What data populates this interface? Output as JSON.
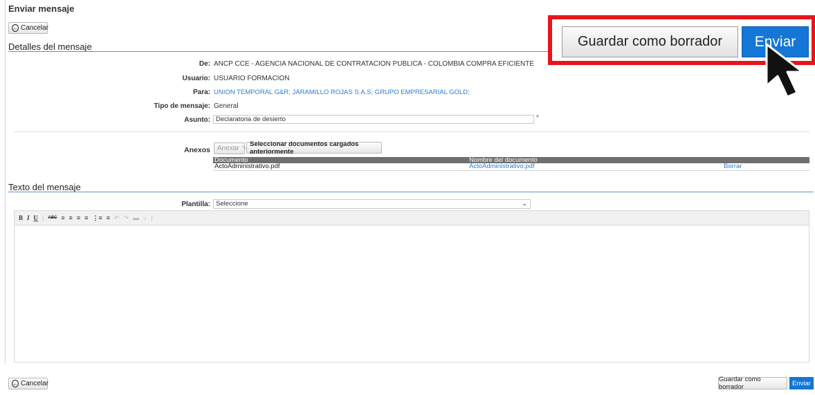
{
  "page": {
    "title": "Enviar mensaje"
  },
  "actions": {
    "cancel_label": "Cancelar",
    "draft_label": "Guardar como borrador",
    "send_label": "Enviar"
  },
  "details": {
    "section_title": "Detalles del mensaje",
    "from_label": "De:",
    "from_value": "ANCP CCE - AGENCIA NACIONAL DE CONTRATACION PUBLICA - COLOMBIA COMPRA EFICIENTE",
    "user_label": "Usuario:",
    "user_value": "USUARIO FORMACION",
    "to_label": "Para:",
    "to_value": "UNION TEMPORAL G&R; JARAMILLO ROJAS S.A.S; GRUPO EMPRESARIAL GOLD;",
    "type_label": "Tipo de mensaje:",
    "type_value": "General",
    "subject_label": "Asunto:",
    "subject_value": "Declaratoria de desierto",
    "required_mark": "*"
  },
  "attachments": {
    "label": "Anexos",
    "attach_button": "Anexar",
    "select_button": "Seleccionar documentos cargados anteriormente",
    "columns": [
      "Documento",
      "Nombre del documento"
    ],
    "rows": [
      {
        "document": "ActoAdministrativo.pdf",
        "name": "ActoAdministrativo.pdf",
        "action": "Borrar"
      }
    ]
  },
  "body": {
    "section_title": "Texto del mensaje",
    "template_label": "Plantilla:",
    "template_value": "Seleccione"
  },
  "toolbar": {
    "bold": "B",
    "italic": "I",
    "underline": "U",
    "strike": "ABC"
  },
  "colors": {
    "accent": "#1476d6",
    "highlight": "#e8141b",
    "link": "#2d7bd1"
  },
  "icons": [
    "back-arrow-icon",
    "attach-clip-icon",
    "chevron-down-icon",
    "cursor-pointer-icon"
  ]
}
